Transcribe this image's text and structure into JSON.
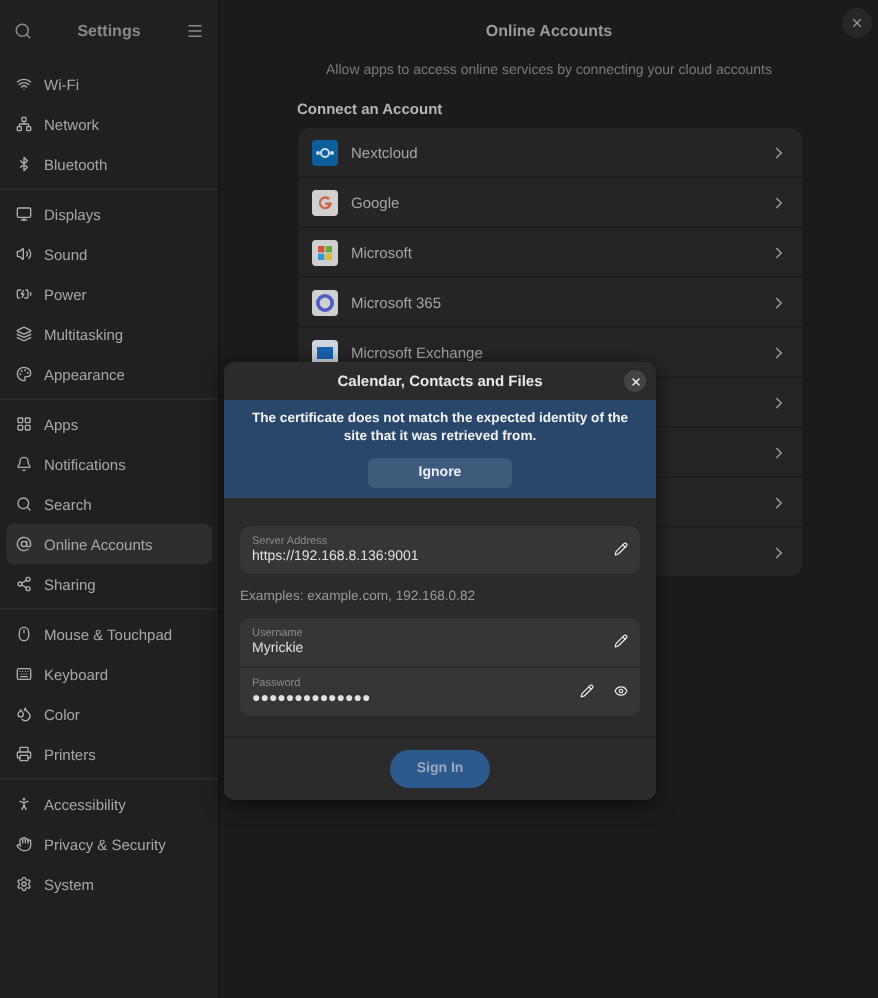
{
  "sidebar": {
    "title": "Settings",
    "groups": [
      [
        {
          "label": "Wi-Fi",
          "selected": false
        },
        {
          "label": "Network",
          "selected": false
        },
        {
          "label": "Bluetooth",
          "selected": false
        }
      ],
      [
        {
          "label": "Displays",
          "selected": false
        },
        {
          "label": "Sound",
          "selected": false
        },
        {
          "label": "Power",
          "selected": false
        },
        {
          "label": "Multitasking",
          "selected": false
        },
        {
          "label": "Appearance",
          "selected": false
        }
      ],
      [
        {
          "label": "Apps",
          "selected": false
        },
        {
          "label": "Notifications",
          "selected": false
        },
        {
          "label": "Search",
          "selected": false
        },
        {
          "label": "Online Accounts",
          "selected": true
        },
        {
          "label": "Sharing",
          "selected": false
        }
      ],
      [
        {
          "label": "Mouse & Touchpad",
          "selected": false
        },
        {
          "label": "Keyboard",
          "selected": false
        },
        {
          "label": "Color",
          "selected": false
        },
        {
          "label": "Printers",
          "selected": false
        }
      ],
      [
        {
          "label": "Accessibility",
          "selected": false
        },
        {
          "label": "Privacy & Security",
          "selected": false
        },
        {
          "label": "System",
          "selected": false
        }
      ]
    ]
  },
  "main": {
    "title": "Online Accounts",
    "description": "Allow apps to access online services by connecting your cloud accounts",
    "section_title": "Connect an Account",
    "accounts": [
      {
        "kind": "rings",
        "name": "Nextcloud"
      },
      {
        "kind": "letter",
        "name": "Google"
      },
      {
        "kind": "squares",
        "name": "Microsoft"
      },
      {
        "kind": "circle",
        "name": "Microsoft 365"
      },
      {
        "kind": "tile",
        "name": "Microsoft Exchange"
      },
      {
        "kind": "covered"
      },
      {
        "kind": "covered"
      },
      {
        "kind": "covered"
      },
      {
        "kind": "covered"
      }
    ]
  },
  "dialog": {
    "title": "Calendar, Contacts and Files",
    "banner": {
      "message": "The certificate does not match the expected identity of the site that it was retrieved from.",
      "button": "Ignore"
    },
    "server": {
      "label": "Server Address",
      "value": "https://192.168.8.136:9001"
    },
    "hint": "Examples: example.com, 192.168.0.82",
    "username": {
      "label": "Username",
      "value": "Myrickie"
    },
    "password": {
      "label": "Password",
      "value": "●●●●●●●●●●●●●●"
    },
    "sign_in": "Sign In"
  }
}
